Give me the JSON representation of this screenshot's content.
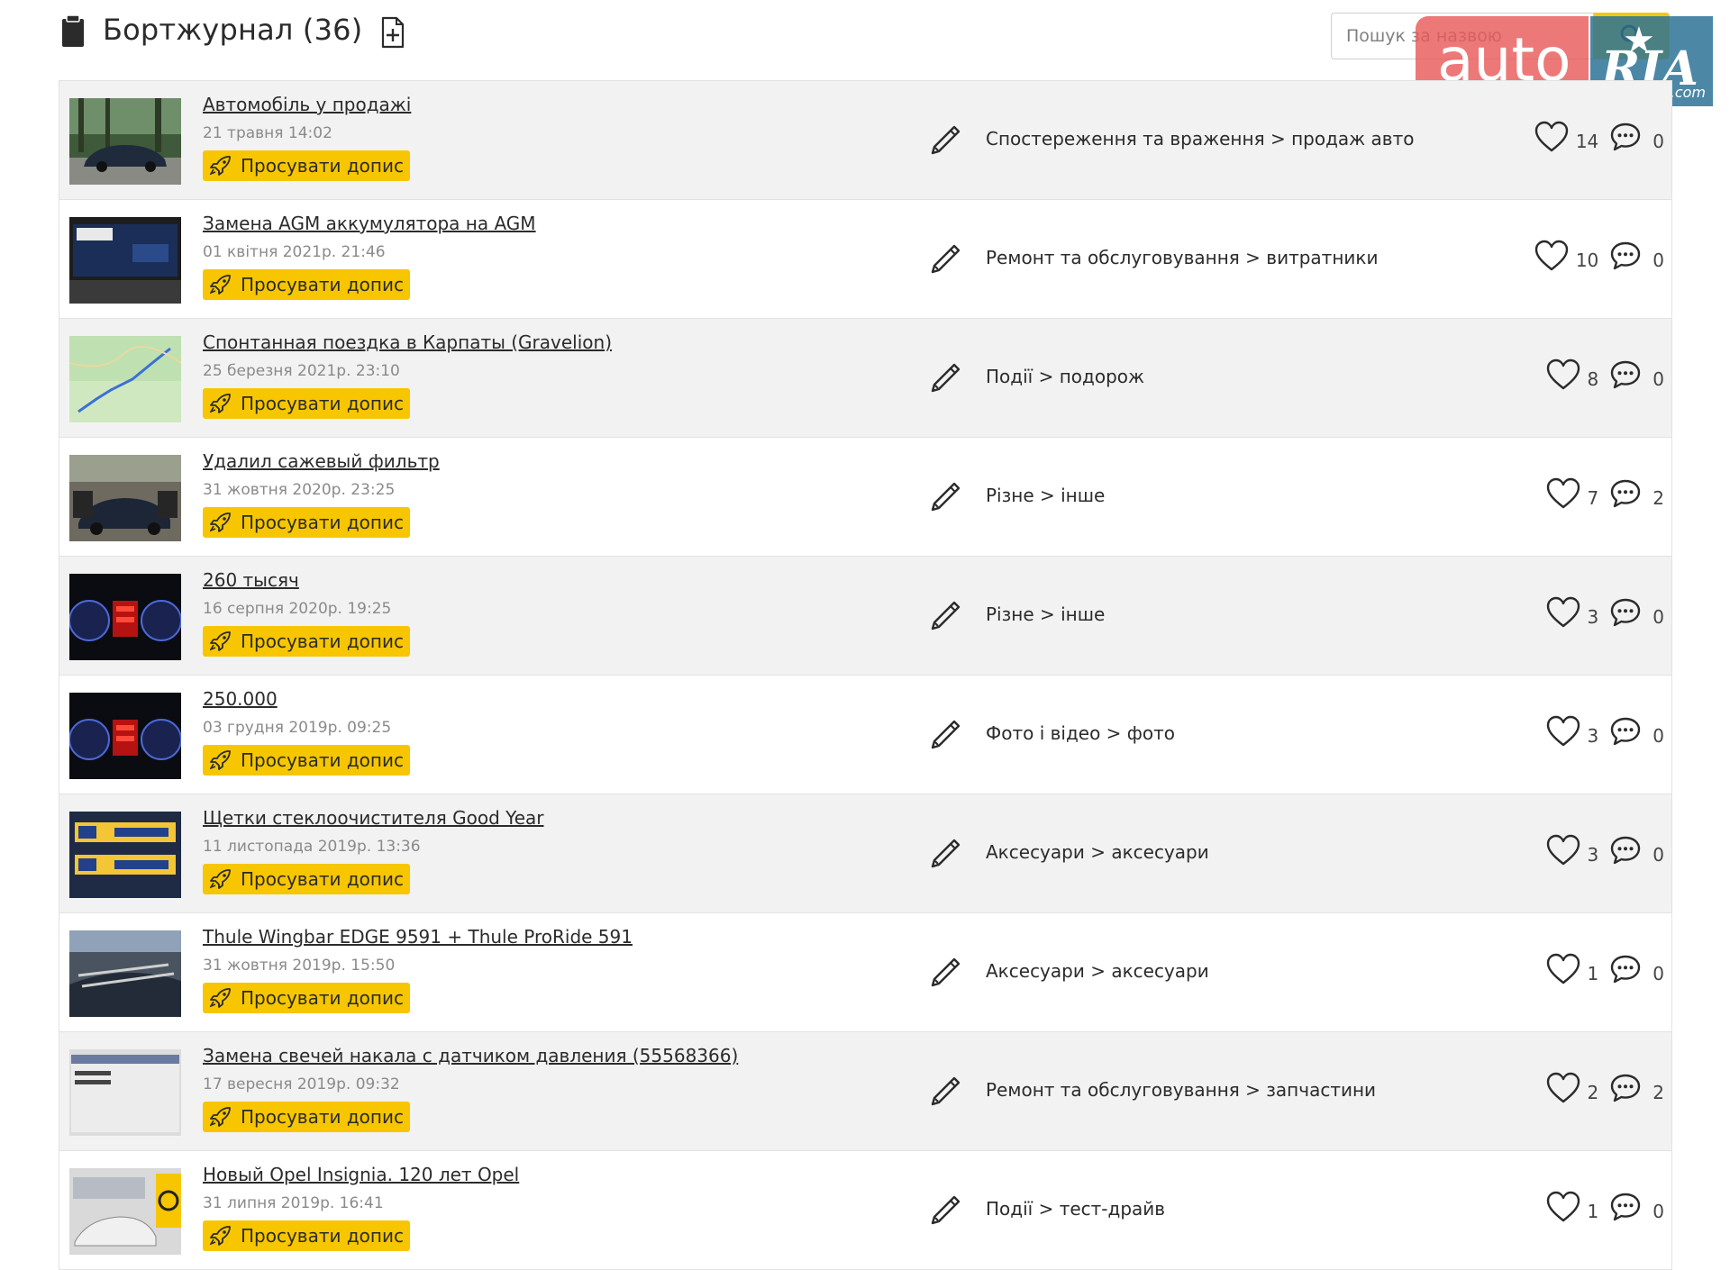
{
  "header": {
    "title": "Бортжурнал (36)",
    "title_icon": "notebook-icon",
    "add_icon": "add-file-icon",
    "search_placeholder": "Пошук за назвою",
    "search_icon": "search-icon"
  },
  "watermark": {
    "auto": "auto",
    "ria": "RIA",
    "com": ".com"
  },
  "promote_label": "Просувати допис",
  "posts": [
    {
      "title": "Автомобіль у продажі",
      "date": "21 травня 14:02",
      "category": "Спостереження та враження > продаж авто",
      "likes": "14",
      "comments": "0",
      "thumb": "car-forest-photo"
    },
    {
      "title": "Замена AGM аккумулятора на AGM",
      "date": "01 квітня 2021р. 21:46",
      "category": "Ремонт та обслуговування > витратники",
      "likes": "10",
      "comments": "0",
      "thumb": "battery-photo"
    },
    {
      "title": "Спонтанная поездка в Карпаты (Gravelion)",
      "date": "25 березня 2021р. 23:10",
      "category": "Події > подорож",
      "likes": "8",
      "comments": "0",
      "thumb": "map-photo"
    },
    {
      "title": "Удалил сажевый фильтр",
      "date": "31 жовтня 2020р. 23:25",
      "category": "Різне > інше",
      "likes": "7",
      "comments": "2",
      "thumb": "car-open-doors-photo"
    },
    {
      "title": "260 тысяч",
      "date": "16 серпня 2020р. 19:25",
      "category": "Різне > інше",
      "likes": "3",
      "comments": "0",
      "thumb": "dashboard-photo"
    },
    {
      "title": "250.000",
      "date": "03 грудня 2019р. 09:25",
      "category": "Фото і відео > фото",
      "likes": "3",
      "comments": "0",
      "thumb": "dashboard-photo"
    },
    {
      "title": "Щетки стеклоочистителя Good Year",
      "date": "11 листопада 2019р. 13:36",
      "category": "Аксесуари > аксесуари",
      "likes": "3",
      "comments": "0",
      "thumb": "wipers-photo"
    },
    {
      "title": "Thule Wingbar EDGE 9591 + Thule ProRide 591",
      "date": "31 жовтня 2019р. 15:50",
      "category": "Аксесуари > аксесуари",
      "likes": "1",
      "comments": "0",
      "thumb": "roof-rack-photo"
    },
    {
      "title": "Замена свечей накала с датчиком давления (55568366)",
      "date": "17 вересня 2019р. 09:32",
      "category": "Ремонт та обслуговування > запчастини",
      "likes": "2",
      "comments": "2",
      "thumb": "screen-photo"
    },
    {
      "title": "Новый Opel Insignia. 120 лет Opel",
      "date": "31 липня 2019р. 16:41",
      "category": "Події > тест-драйв",
      "likes": "1",
      "comments": "0",
      "thumb": "showroom-photo"
    }
  ],
  "colors": {
    "accent": "#f7c600",
    "shade_row": "#f2f2f2",
    "border": "#e2e2e2"
  }
}
